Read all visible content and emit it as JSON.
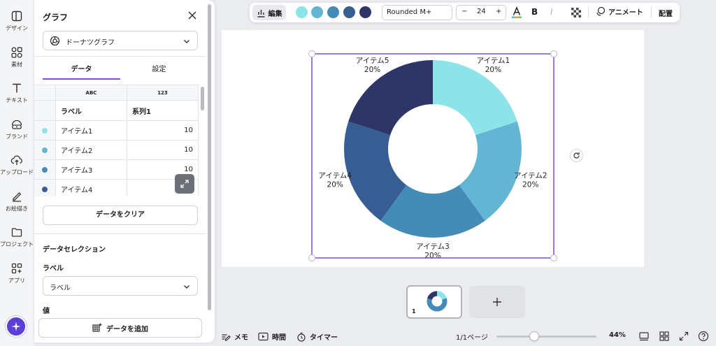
{
  "rail": {
    "items": [
      {
        "label": "デザイン",
        "icon": "layout-icon"
      },
      {
        "label": "素材",
        "icon": "elements-icon"
      },
      {
        "label": "テキスト",
        "icon": "text-icon"
      },
      {
        "label": "ブランド",
        "icon": "brand-icon"
      },
      {
        "label": "アップロード",
        "icon": "upload-icon"
      },
      {
        "label": "お絵描き",
        "icon": "draw-icon"
      },
      {
        "label": "プロジェクト",
        "icon": "folder-icon"
      },
      {
        "label": "アプリ",
        "icon": "apps-icon"
      }
    ]
  },
  "panel": {
    "title": "グラフ",
    "chart_type": "ドーナツグラフ",
    "tabs": [
      {
        "label": "データ"
      },
      {
        "label": "設定"
      }
    ],
    "grid": {
      "type_row": [
        "ABC",
        "123"
      ],
      "header": [
        "ラベル",
        "系列1"
      ],
      "rows": [
        {
          "label": "アイテム1",
          "value": "10",
          "color": "#8ce3e8"
        },
        {
          "label": "アイテム2",
          "value": "10",
          "color": "#62b6d3"
        },
        {
          "label": "アイテム3",
          "value": "10",
          "color": "#448bb8"
        },
        {
          "label": "アイテム4",
          "value": "10",
          "color": "#375d94"
        }
      ]
    },
    "clear_button": "データをクリア",
    "selection_title": "データセレクション",
    "label_section": "ラベル",
    "label_select": "ラベル",
    "value_section": "値",
    "add_data_button": "データを追加"
  },
  "toolbar": {
    "edit_label": "編集",
    "colors": [
      "#8ce3e8",
      "#62b6d3",
      "#448bb8",
      "#375d94",
      "#2e3567"
    ],
    "font": "Rounded M+",
    "font_size": "24",
    "minus": "−",
    "plus": "+",
    "bold": "B",
    "italic": "I",
    "animate_label": "アニメート",
    "position_label": "配置"
  },
  "chart_data": {
    "type": "pie",
    "donut": true,
    "categories": [
      "アイテム1",
      "アイテム2",
      "アイテム3",
      "アイテム4",
      "アイテム5"
    ],
    "values": [
      10,
      10,
      10,
      10,
      10
    ],
    "percent_labels": [
      "20%",
      "20%",
      "20%",
      "20%",
      "20%"
    ],
    "colors": [
      "#8ce3e8",
      "#62b6d3",
      "#448bb8",
      "#375d94",
      "#2e3567"
    ],
    "title": ""
  },
  "pages": {
    "current_page_number": "1",
    "add_page_icon": "plus-icon"
  },
  "bottom": {
    "notes": "メモ",
    "timer_time": "時間",
    "timer": "タイマー",
    "page_indicator": "1/1ページ",
    "zoom": "44%",
    "zoom_level": 0.38
  }
}
